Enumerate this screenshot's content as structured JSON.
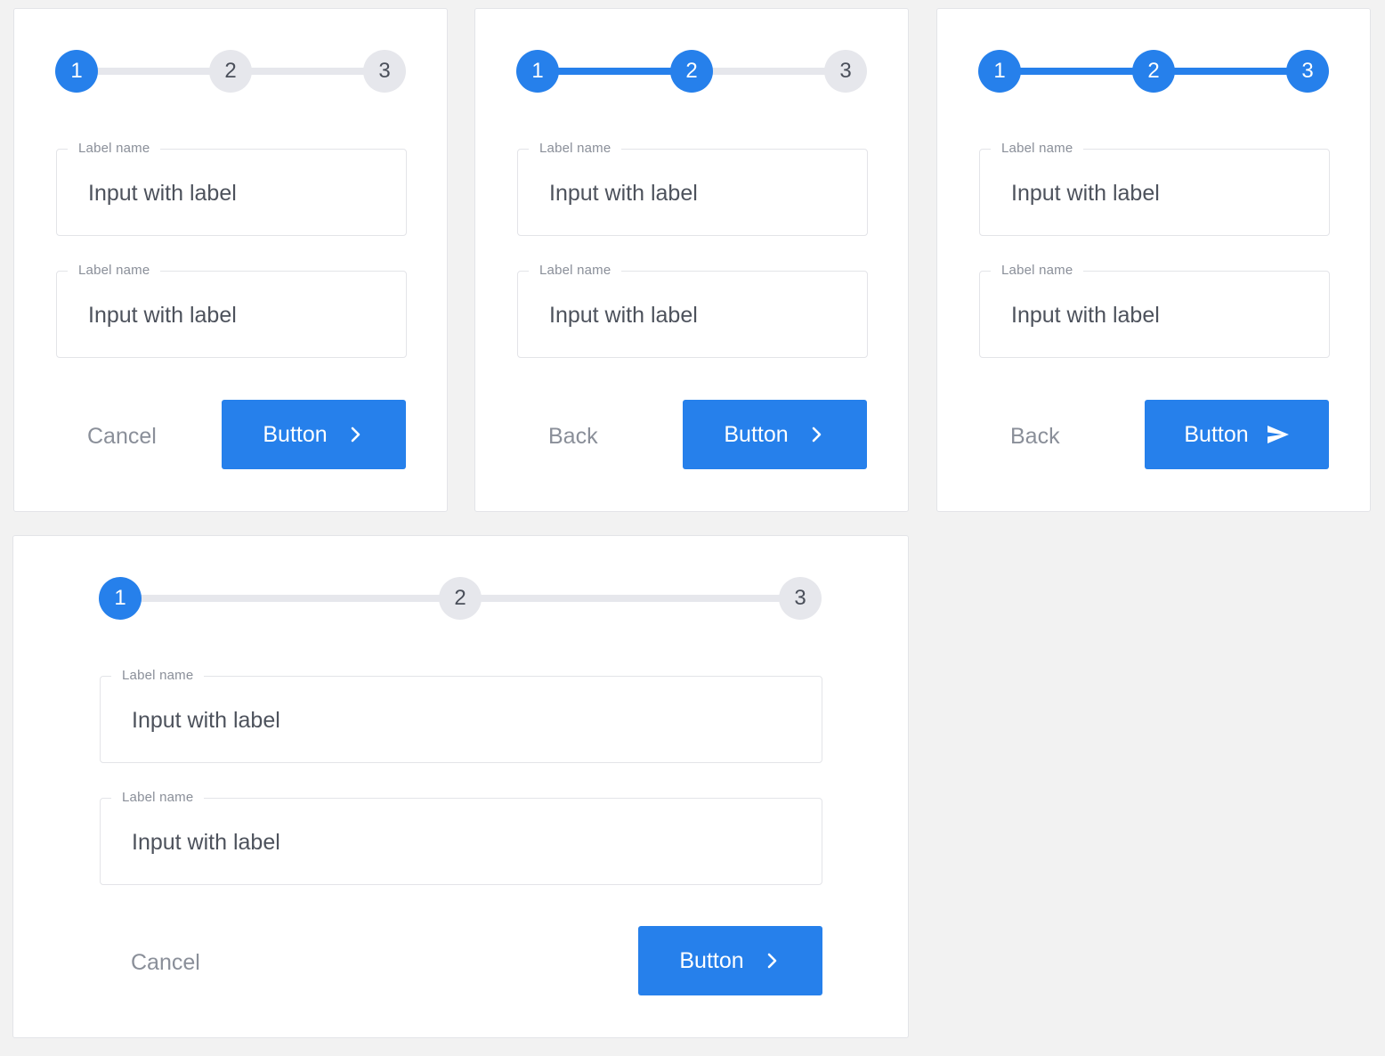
{
  "colors": {
    "accent": "#2680eb",
    "inactive": "#e6e7ec",
    "background": "#f2f2f2"
  },
  "cards": [
    {
      "steps": [
        "1",
        "2",
        "3"
      ],
      "current_step": 1,
      "fields": [
        {
          "label": "Label name",
          "value": "Input with label"
        },
        {
          "label": "Label name",
          "value": "Input with label"
        }
      ],
      "secondary_label": "Cancel",
      "primary_label": "Button",
      "primary_icon": "chevron-right-icon"
    },
    {
      "steps": [
        "1",
        "2",
        "3"
      ],
      "current_step": 2,
      "fields": [
        {
          "label": "Label name",
          "value": "Input with label"
        },
        {
          "label": "Label name",
          "value": "Input with label"
        }
      ],
      "secondary_label": "Back",
      "primary_label": "Button",
      "primary_icon": "chevron-right-icon"
    },
    {
      "steps": [
        "1",
        "2",
        "3"
      ],
      "current_step": 3,
      "fields": [
        {
          "label": "Label name",
          "value": "Input with label"
        },
        {
          "label": "Label name",
          "value": "Input with label"
        }
      ],
      "secondary_label": "Back",
      "primary_label": "Button",
      "primary_icon": "send-icon"
    },
    {
      "steps": [
        "1",
        "2",
        "3"
      ],
      "current_step": 1,
      "fields": [
        {
          "label": "Label name",
          "value": "Input with label"
        },
        {
          "label": "Label name",
          "value": "Input with label"
        }
      ],
      "secondary_label": "Cancel",
      "primary_label": "Button",
      "primary_icon": "chevron-right-icon"
    }
  ]
}
